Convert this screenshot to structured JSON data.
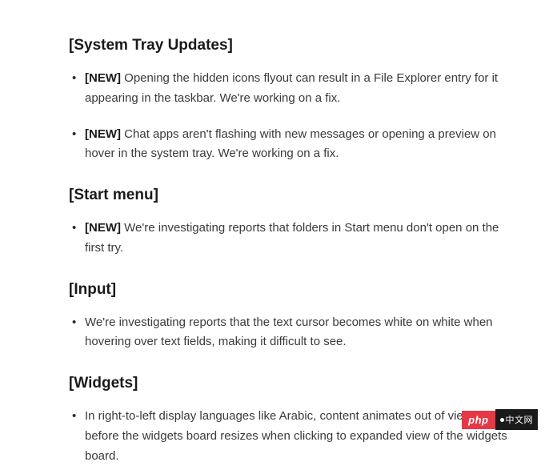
{
  "sections": [
    {
      "heading": "[System Tray Updates]",
      "items": [
        {
          "tag": "[NEW]",
          "text": "Opening the hidden icons flyout can result in a File Explorer entry for it appearing in the taskbar. We're working on a fix."
        },
        {
          "tag": "[NEW]",
          "text": "Chat apps aren't flashing with new messages or opening a preview on hover in the system tray. We're working on a fix."
        }
      ]
    },
    {
      "heading": "[Start menu]",
      "items": [
        {
          "tag": "[NEW]",
          "text": "We're investigating reports that folders in Start menu don't open on the first try."
        }
      ]
    },
    {
      "heading": "[Input]",
      "items": [
        {
          "tag": "",
          "text": "We're investigating reports that the text cursor becomes white on white when hovering over text fields, making it difficult to see."
        }
      ]
    },
    {
      "heading": "[Widgets]",
      "items": [
        {
          "tag": "",
          "text": "In right-to-left display languages like Arabic, content animates out of view before the widgets board resizes when clicking to expanded view of the widgets board."
        }
      ]
    }
  ],
  "badge": {
    "left": "php",
    "right": "中文网"
  }
}
